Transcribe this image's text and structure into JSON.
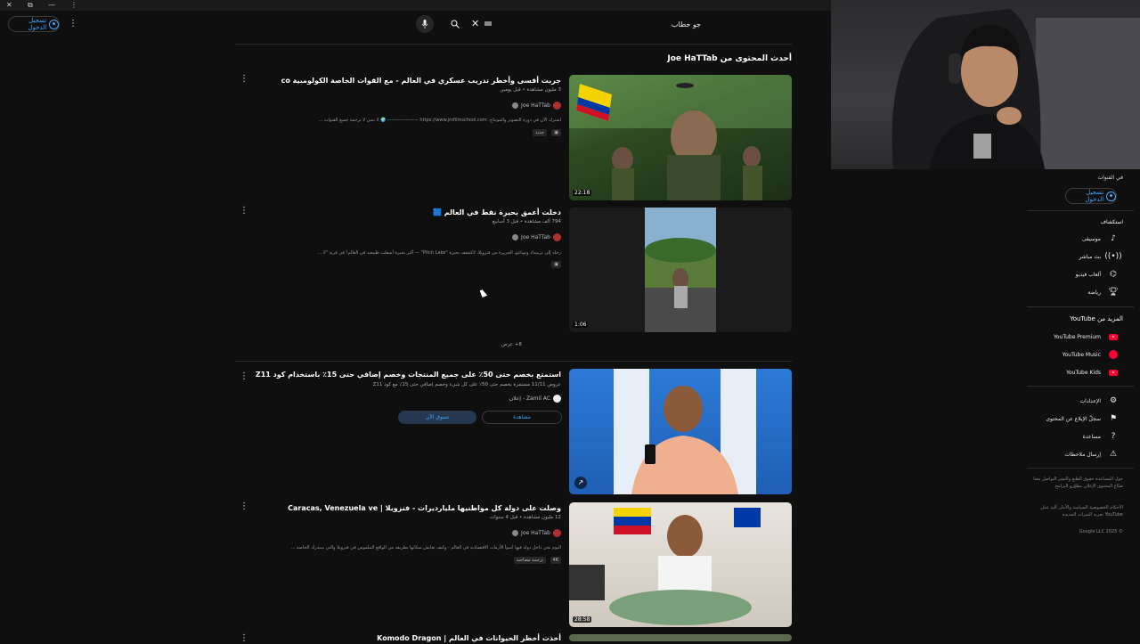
{
  "titlebar": {
    "close": "✕",
    "restore": "⧉",
    "minimize": "—",
    "more": "⋮"
  },
  "header": {
    "signin_label": "تسجيل الدخول",
    "search_value": "جو حطاب",
    "search_icon": "search-icon",
    "mic_icon": "microphone-icon",
    "clear_icon": "✕"
  },
  "shelf": {
    "title": "أحدث المحتوى من Joe HaTTab"
  },
  "videos": [
    {
      "title": "جربت أقسى وأخطر تدريب عسكري في العالم - مع القوات الخاصة الكولومبية co",
      "meta": "3 مليون مشاهدة • قبل يومين",
      "channel": "Joe HaTTab",
      "description": "اشترك الآن في دورة التصوير والمونتاج: https://www.jmfilmschool.com ——————— 🌍 لا تنس لا ترجمة جميع القنوات ...",
      "chip": "جديد",
      "duration": "22:18"
    },
    {
      "title": "دخلت أعمق بحيرة نفط في العالم 🟦",
      "meta": "794 ألف مشاهدة • قبل 3 أسابيع",
      "channel": "Joe HaTTab",
      "description": "رحلة إلى ترينيداد وتوباغو، الجزيرة من فنزويلا، لاكتشف بحيرة \"Pitch Lake\" — أكبر بحيرة أسفلت طبيعية في العالم! في قرية \"لا ...",
      "duration": "1:06"
    },
    {
      "title": "استمتع بخصم حتى 50٪ على جميع المنتجات وخصم إضافي حتى 15٪ باستخدام كود Z11",
      "meta": "عروض 11/11 مستمرة بخصم حتى 50٪ على كل شيء وخصم إضافي حتى 15٪ مع كود Z11",
      "channel": "Zamil AC - إعلان",
      "btn_watch": "مشاهدة",
      "btn_shop": "تسوق الآن"
    },
    {
      "title": "وصلت على دولة كل مواطنيها مليارديرات - فنزويلا | Caracas, Venezuela ve",
      "meta": "12 مليون مشاهدة • قبل 4 سنوات",
      "channel": "Joe HaTTab",
      "description": "اليوم نحن داخل دولة فيها أسوأ الأزمات الاقتصادية في العالم - وكيف تعايش سكانها بطريقة من الواقع الملموس في فنزويلا والتي ستدرك الخاصة ...",
      "chip": "ترجمة مصاحبة",
      "chip2": "4K",
      "duration": "28:58"
    },
    {
      "title": "أخذت أخطر الحيوانات في العالم | Komodo Dragon"
    }
  ],
  "more_label": "8+ عرض",
  "sidebar": {
    "top_text": "في القنوات",
    "signin_label": "تسجيل الدخول",
    "explore_header": "استكشاف",
    "explore": [
      {
        "label": "موسيقى",
        "icon": "music-icon"
      },
      {
        "label": "بث مباشر",
        "icon": "live-icon"
      },
      {
        "label": "ألعاب فيديو",
        "icon": "gaming-icon"
      },
      {
        "label": "رياضة",
        "icon": "trophy-icon"
      }
    ],
    "more_header": "المزيد من YouTube",
    "more": [
      {
        "label": "YouTube Premium"
      },
      {
        "label": "YouTube Music"
      },
      {
        "label": "YouTube Kids"
      }
    ],
    "settings": [
      {
        "label": "الإعدادات",
        "icon": "gear-icon"
      },
      {
        "label": "سجلّ الإبلاغ عن المحتوى",
        "icon": "flag-icon"
      },
      {
        "label": "مساعدة",
        "icon": "help-icon"
      },
      {
        "label": "إرسال ملاحظات",
        "icon": "feedback-icon"
      }
    ],
    "footer1": "حول المساعدة حقوق الطبع والنشر التواصل معنا صنّاع المحتوى الإعلان مطوّرو البرامج",
    "footer2": "الأحكام الخصوصية السياسة والأمان آلية عمل YouTube تجربة الميزات الجديدة",
    "copyright": "© 2025 Google LLC"
  },
  "colors": {
    "accent": "#3ea6ff",
    "bg": "#0f0f0f",
    "brand_red": "#ff0033"
  }
}
